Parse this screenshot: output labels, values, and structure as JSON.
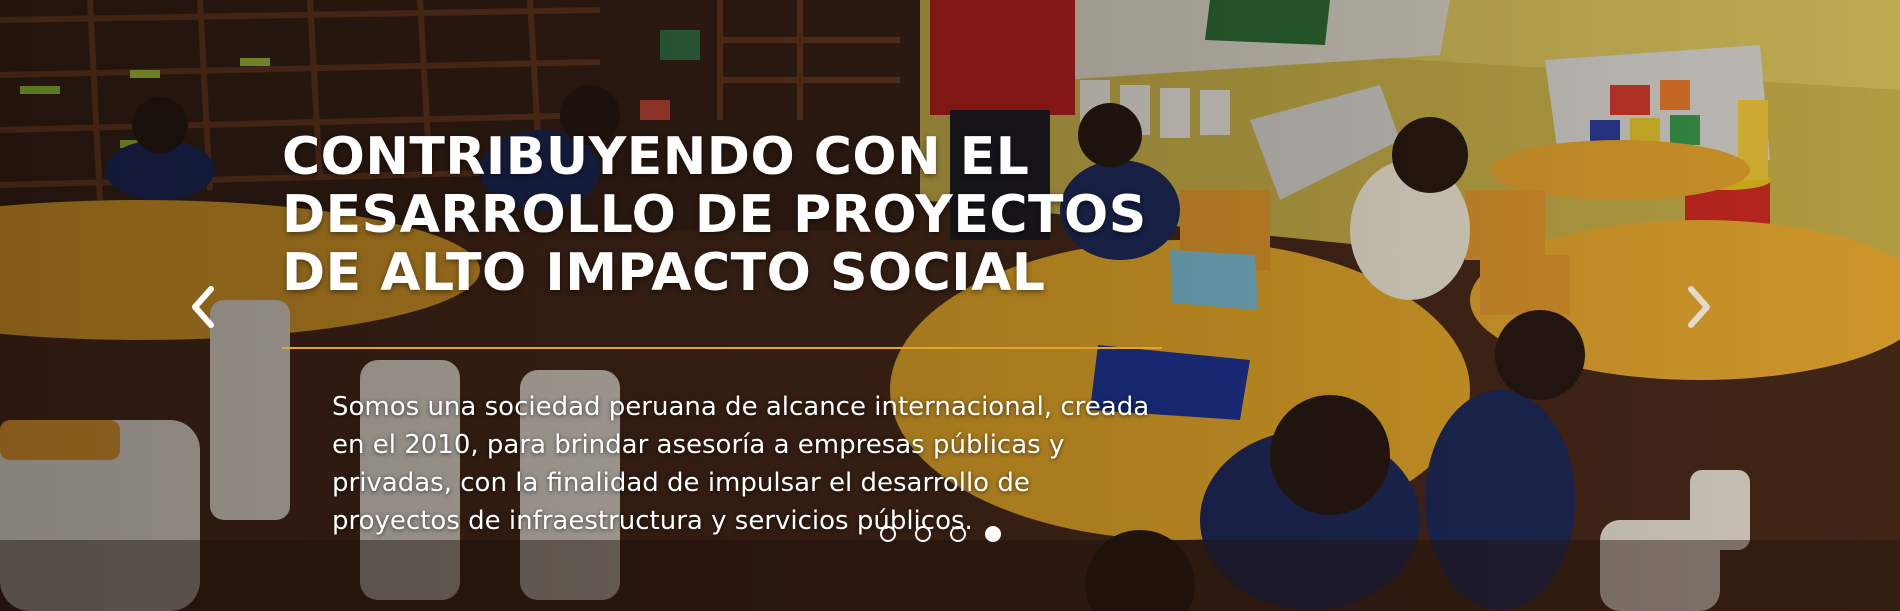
{
  "slider": {
    "title_lines": [
      "CONTRIBUYENDO CON EL",
      "DESARROLLO DE PROYECTOS",
      "DE ALTO IMPACTO SOCIAL"
    ],
    "description_lines": [
      "Somos una sociedad peruana de alcance internacional, creada",
      "en el 2010, para brindar asesoría a empresas públicas y",
      "privadas, con la finalidad de impulsar el desarrollo de",
      "proyectos de infraestructura y servicios públicos."
    ],
    "prev_icon": "chevron-left-icon",
    "next_icon": "chevron-right-icon",
    "slide_count": 4,
    "active_slide": 4
  },
  "colors": {
    "divider": "#e3a228",
    "text": "#ffffff",
    "table_yellow": "#f2b233",
    "wall_yellow": "#ead46a"
  }
}
